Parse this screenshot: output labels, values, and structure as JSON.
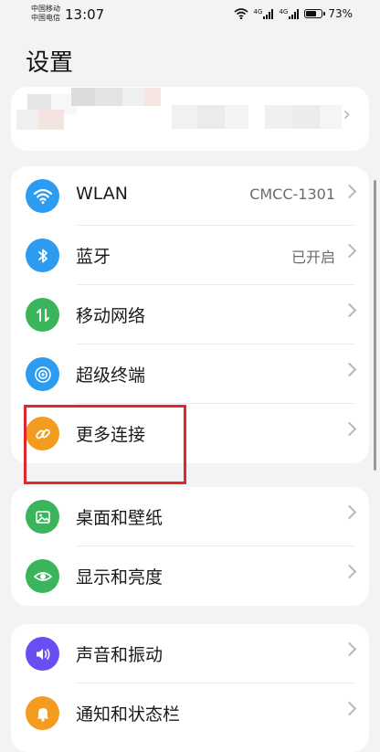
{
  "status_bar": {
    "carrier_1": "中国移动",
    "carrier_2": "中国电信",
    "time": "13:07",
    "network_tag_1": "4G",
    "network_tag_2": "4G",
    "battery_percent": "73%",
    "battery_level": 0.73
  },
  "page": {
    "title": "设置"
  },
  "groups": [
    {
      "items": [
        {
          "label": "WLAN",
          "value": "CMCC-1301",
          "icon": "wifi-icon",
          "color": "#2d9cf0"
        },
        {
          "label": "蓝牙",
          "value": "已开启",
          "icon": "bluetooth-icon",
          "color": "#2d9cf0"
        },
        {
          "label": "移动网络",
          "value": "",
          "icon": "mobile-data-icon",
          "color": "#3bb55b"
        },
        {
          "label": "超级终端",
          "value": "",
          "icon": "super-device-icon",
          "color": "#2d9cf0"
        },
        {
          "label": "更多连接",
          "value": "",
          "icon": "link-icon",
          "color": "#f39c1f"
        }
      ]
    },
    {
      "items": [
        {
          "label": "桌面和壁纸",
          "value": "",
          "icon": "wallpaper-icon",
          "color": "#3bb55b"
        },
        {
          "label": "显示和亮度",
          "value": "",
          "icon": "eye-icon",
          "color": "#3bb55b"
        }
      ]
    },
    {
      "items": [
        {
          "label": "声音和振动",
          "value": "",
          "icon": "sound-icon",
          "color": "#6a4ef2"
        },
        {
          "label": "通知和状态栏",
          "value": "",
          "icon": "bell-icon",
          "color": "#f39c1f"
        }
      ]
    }
  ],
  "colors": {
    "highlight_box": "#e3262c",
    "background": "#f1f3f5"
  }
}
